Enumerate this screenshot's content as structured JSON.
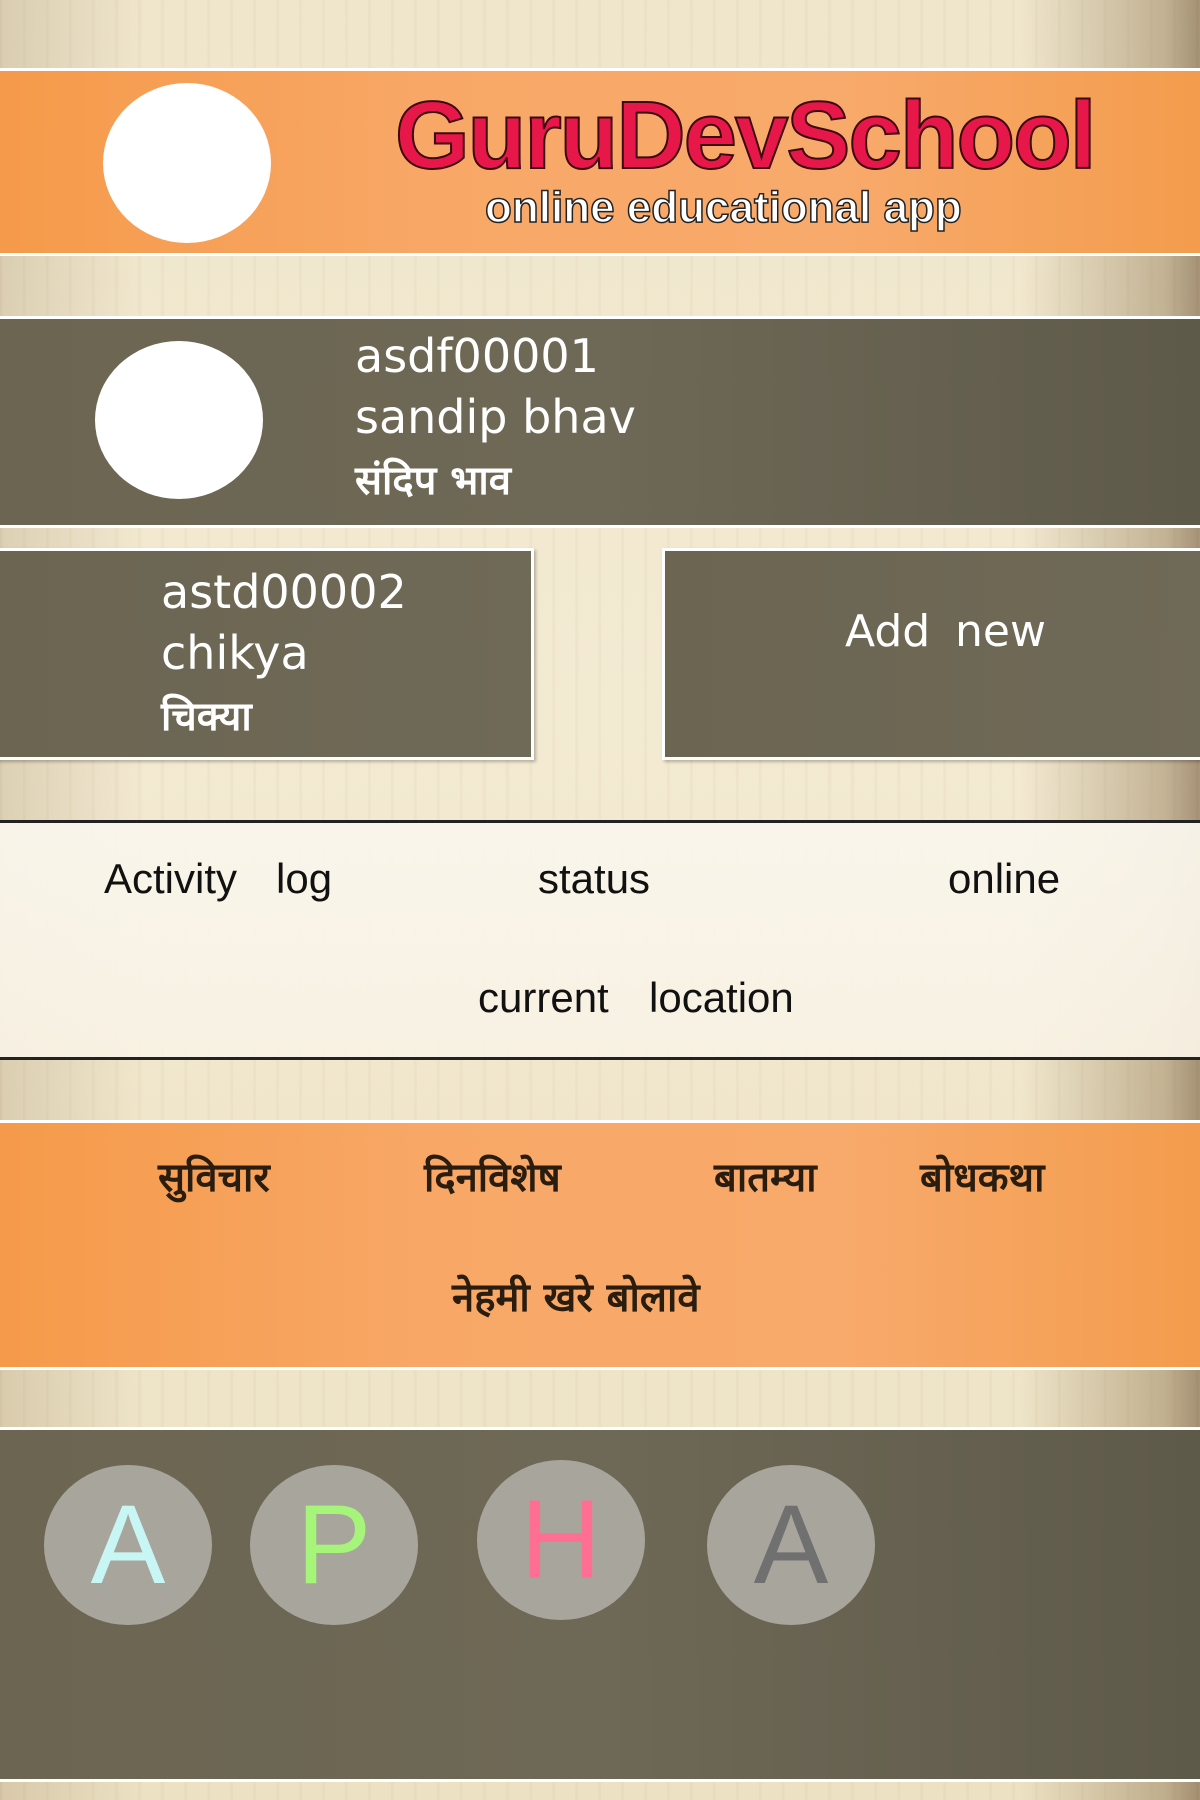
{
  "header": {
    "title": "GuruDevSchool",
    "subtitle": "online educational app"
  },
  "profiles": [
    {
      "id": "asdf00001",
      "name_en": "sandip bhav",
      "name_mr": "संदिप भाव"
    },
    {
      "id": "astd00002",
      "name_en": "chikya",
      "name_mr": "चिक्या"
    }
  ],
  "add_new": {
    "word1": "Add",
    "word2": "new"
  },
  "activity": {
    "log_word1": "Activity",
    "log_word2": "log",
    "status": "status",
    "online": "online",
    "location_word1": "current",
    "location_word2": "location"
  },
  "topics": {
    "items": [
      "सुविचार",
      "दिनविशेष",
      "बातम्या",
      "बोधकथा"
    ],
    "quote": "नेहमी खरे बोलावे"
  },
  "bottom_buttons": [
    {
      "letter": "A",
      "color": "#c8f6f5"
    },
    {
      "letter": "P",
      "color": "#a6f47a"
    },
    {
      "letter": "H",
      "color": "#ff6f93"
    },
    {
      "letter": "A",
      "color": "#707070"
    }
  ]
}
